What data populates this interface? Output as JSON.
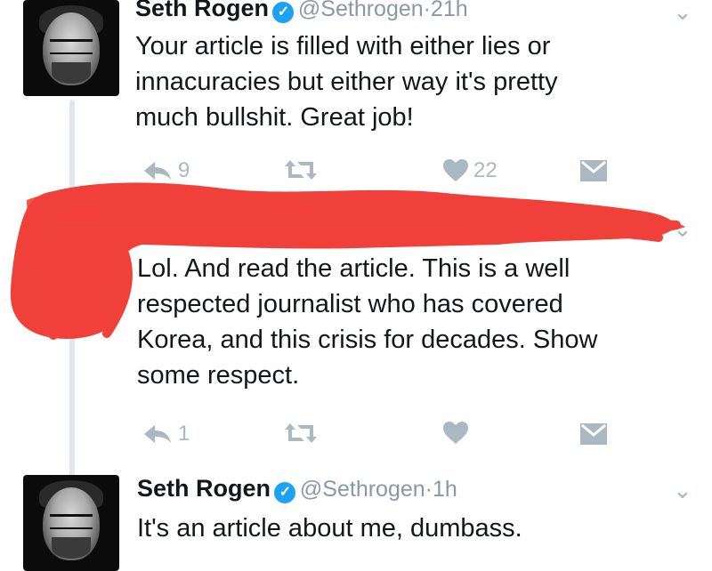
{
  "tweets": [
    {
      "name": "Seth Rogen",
      "handle": "@Sethrogen",
      "time": "21h",
      "lines": [
        "Your article is filled with either lies or",
        "innacuracies but either way it's pretty",
        "much bullshit. Great job!"
      ],
      "reply_count": "9",
      "like_count": "22"
    },
    {
      "lines": [
        "Lol. And read the article. This is a well",
        "respected journalist who has covered",
        "Korea, and this crisis for decades. Show",
        "some respect."
      ],
      "reply_count": "1"
    },
    {
      "name": "Seth Rogen",
      "handle": "@Sethrogen",
      "time": "1h",
      "lines": [
        "It's an article about me, dumbass."
      ]
    }
  ],
  "separator": "·",
  "icons": {
    "reply": "reply-icon",
    "retweet": "retweet-icon",
    "like": "heart-icon",
    "dm": "envelope-icon",
    "more": "chevron-down-icon",
    "verified": "verified-badge-icon"
  },
  "colors": {
    "scribble": "#f0403a",
    "action_gray": "#aab8c2",
    "handle_gray": "#8899a6",
    "verified_blue": "#1da1f2"
  }
}
